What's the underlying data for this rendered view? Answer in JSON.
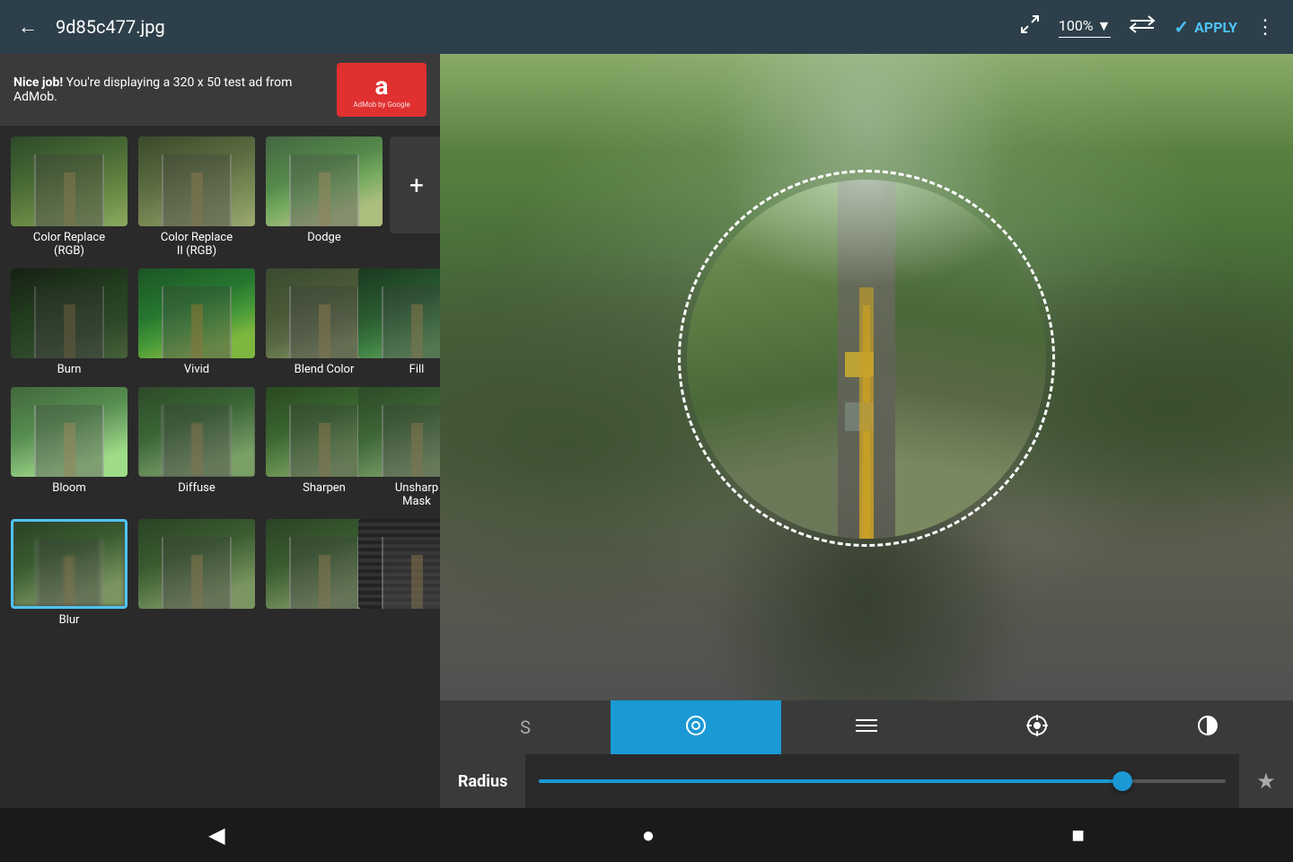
{
  "header": {
    "back_label": "←",
    "filename": "9d85c477.jpg",
    "zoom_level": "100%",
    "apply_label": "APPLY",
    "fullscreen_icon": "⛶",
    "swap_icon": "⇄",
    "more_icon": "⋮"
  },
  "ad_banner": {
    "text_bold": "Nice job!",
    "text_normal": " You're displaying a 320 x 50 test ad from AdMob.",
    "logo_letter": "a",
    "logo_sub": "AdMob by Google"
  },
  "filters": [
    {
      "label": "Color Replace\n(RGB)",
      "class": "color-replace"
    },
    {
      "label": "Color Replace\nII (RGB)",
      "class": "color-replace2"
    },
    {
      "label": "Dodge",
      "class": "dodge"
    },
    {
      "label": "Burn",
      "class": "burn"
    },
    {
      "label": "Vivid",
      "class": "vivid"
    },
    {
      "label": "Blend Color",
      "class": "blend-color"
    },
    {
      "label": "Fill",
      "class": "fill"
    },
    {
      "label": "Bloom",
      "class": "bloom"
    },
    {
      "label": "Diffuse",
      "class": "diffuse"
    },
    {
      "label": "Sharpen",
      "class": "sharpen"
    },
    {
      "label": "Unsharp Mask",
      "class": "unsharp"
    },
    {
      "label": "Blur",
      "class": "blur",
      "selected": true
    },
    {
      "label": "",
      "class": "bottom1"
    },
    {
      "label": "",
      "class": "bottom2"
    },
    {
      "label": "",
      "class": "bottom3"
    }
  ],
  "add_filter_label": "+",
  "tools": [
    {
      "label": "S",
      "type": "text",
      "active": false
    },
    {
      "label": "◎",
      "type": "circle",
      "active": true
    },
    {
      "label": "≡",
      "type": "lines",
      "active": false
    },
    {
      "label": "⊙",
      "type": "target",
      "active": false
    },
    {
      "label": "◑",
      "type": "half-circle",
      "active": false
    }
  ],
  "params": {
    "radius_label": "Radius",
    "slider_percent": 85,
    "star_icon": "★"
  },
  "nav": {
    "back_icon": "◀",
    "home_icon": "●",
    "square_icon": "■"
  }
}
